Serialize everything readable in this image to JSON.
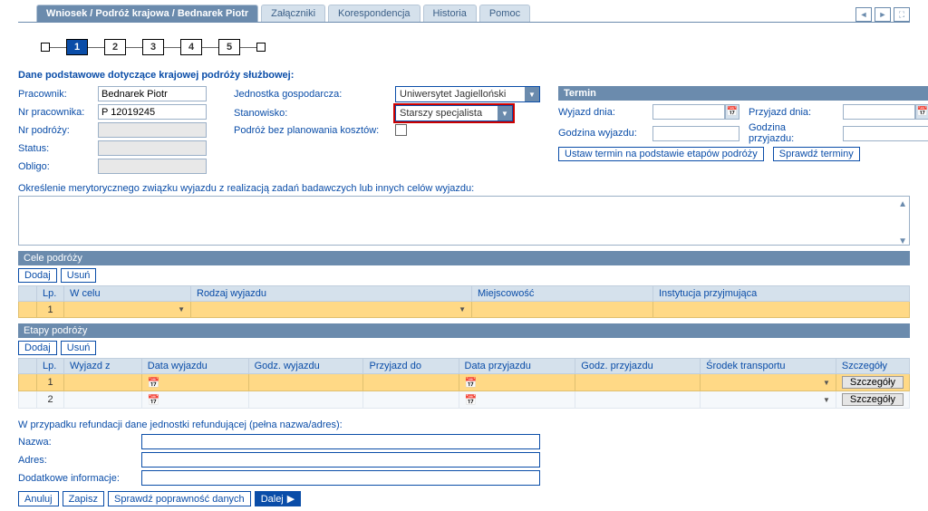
{
  "tabs": {
    "active": "Wniosek / Podróż krajowa / Bednarek Piotr",
    "items": [
      "Załączniki",
      "Korespondencja",
      "Historia",
      "Pomoc"
    ]
  },
  "stepper": {
    "steps": [
      "1",
      "2",
      "3",
      "4",
      "5"
    ],
    "active": "1"
  },
  "section_title": "Dane podstawowe dotyczące krajowej podróży służbowej:",
  "left_fields": {
    "pracownik_label": "Pracownik:",
    "pracownik_value": "Bednarek Piotr",
    "nrpr_label": "Nr pracownika:",
    "nrpr_value": "P 12019245",
    "nrpod_label": "Nr podróży:",
    "nrpod_value": "",
    "status_label": "Status:",
    "status_value": "",
    "obligo_label": "Obligo:",
    "obligo_value": ""
  },
  "mid_fields": {
    "jednostka_label": "Jednostka gospodarcza:",
    "jednostka_value": "Uniwersytet Jagielloński",
    "stanowisko_label": "Stanowisko:",
    "stanowisko_value": "Starszy specjalista",
    "noplan_label": "Podróż bez planowania kosztów:"
  },
  "termin": {
    "header": "Termin",
    "wyjazd_label": "Wyjazd dnia:",
    "przyjazd_label": "Przyjazd dnia:",
    "gwyj_label": "Godzina wyjazdu:",
    "gprz_label": "Godzina przyjazdu:",
    "btn1": "Ustaw termin na podstawie etapów podróży",
    "btn2": "Sprawdź terminy"
  },
  "desc_label": "Określenie merytorycznego związku wyjazdu z realizacją zadań badawczych lub innych celów wyjazdu:",
  "cele": {
    "header": "Cele podróży",
    "btn_add": "Dodaj",
    "btn_del": "Usuń",
    "cols": {
      "lp": "Lp.",
      "cel": "W celu",
      "rodzaj": "Rodzaj wyjazdu",
      "miejsc": "Miejscowość",
      "inst": "Instytucja przyjmująca"
    },
    "rows": [
      {
        "lp": "1"
      }
    ]
  },
  "etapy": {
    "header": "Etapy podróży",
    "btn_add": "Dodaj",
    "btn_del": "Usuń",
    "cols": {
      "lp": "Lp.",
      "wz": "Wyjazd z",
      "dw": "Data wyjazdu",
      "gw": "Godz. wyjazdu",
      "pd": "Przyjazd do",
      "dp": "Data przyjazdu",
      "gp": "Godz. przyjazdu",
      "st": "Środek transportu",
      "sz": "Szczegóły"
    },
    "rows": [
      {
        "lp": "1",
        "detail": "Szczegóły"
      },
      {
        "lp": "2",
        "detail": "Szczegóły"
      }
    ]
  },
  "refund": {
    "title": "W przypadku refundacji dane jednostki refundującej (pełna nazwa/adres):",
    "nazwa_label": "Nazwa:",
    "adres_label": "Adres:",
    "dod_label": "Dodatkowe informacje:"
  },
  "bottom": {
    "anuluj": "Anuluj",
    "zapisz": "Zapisz",
    "sprawdz": "Sprawdź poprawność danych",
    "dalej": "Dalej"
  }
}
